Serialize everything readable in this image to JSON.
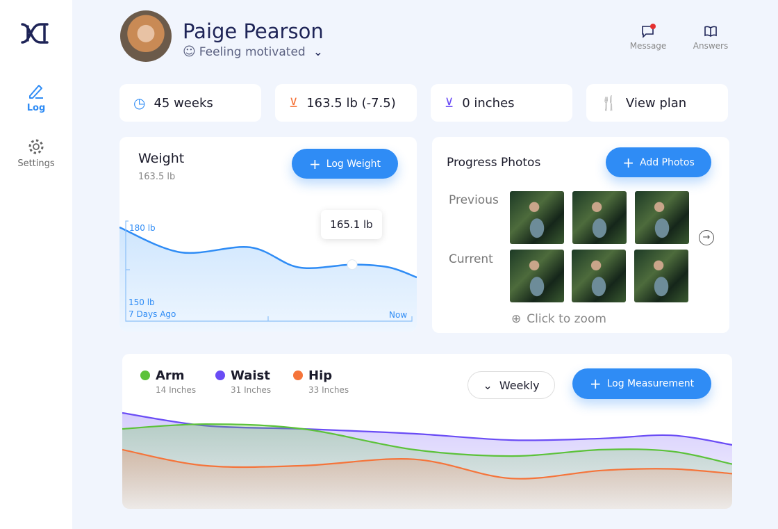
{
  "sidebar": {
    "items": [
      {
        "label": "Log",
        "icon": "pencil-icon",
        "active": true
      },
      {
        "label": "Settings",
        "icon": "gear-icon"
      }
    ]
  },
  "header": {
    "name": "Paige Pearson",
    "mood": "Feeling motivated",
    "actions": [
      {
        "label": "Message",
        "icon": "message-icon",
        "has_notification": true
      },
      {
        "label": "Answers",
        "icon": "book-icon"
      }
    ]
  },
  "stats": [
    {
      "label": "45 weeks",
      "icon": "clock-icon",
      "color": "#2f8cf5"
    },
    {
      "label": "163.5 lb (-7.5)",
      "icon": "arrow-down-circle-icon",
      "color": "#f5743a"
    },
    {
      "label": "0 inches",
      "icon": "arrow-down-circle-icon",
      "color": "#6a4cf5"
    },
    {
      "label": "View plan",
      "icon": "fork-knife-icon",
      "color": "#5cc23a"
    }
  ],
  "weight": {
    "title": "Weight",
    "current": "163.5 lb",
    "button": "Log Weight",
    "tooltip": "165.1 lb"
  },
  "photos": {
    "title": "Progress Photos",
    "button": "Add Photos",
    "previous_label": "Previous",
    "current_label": "Current",
    "zoom_hint": "Click to zoom"
  },
  "measure": {
    "legend": [
      {
        "name": "Arm",
        "value": "14 Inches",
        "color": "#5cc23a"
      },
      {
        "name": "Waist",
        "value": "31 Inches",
        "color": "#6a4cf5"
      },
      {
        "name": "Hip",
        "value": "33 Inches",
        "color": "#f5743a"
      }
    ],
    "period": "Weekly",
    "button": "Log Measurement"
  },
  "chart_data": [
    {
      "type": "area",
      "ytick_labels": [
        "180 lb",
        "150 lb"
      ],
      "xtick_labels": [
        "7 Days Ago",
        "Now"
      ],
      "ylim": [
        150,
        180
      ],
      "x": [
        0,
        1,
        2,
        3,
        4,
        5,
        6
      ],
      "values": [
        180,
        170,
        172,
        164,
        165.1,
        164,
        160
      ],
      "highlight": {
        "x": 4,
        "value": 165.1,
        "label": "165.1 lb"
      },
      "color": "#2f8cf5"
    },
    {
      "type": "area",
      "series": [
        {
          "name": "Waist",
          "values": [
            60,
            52,
            50,
            47,
            43,
            44,
            46,
            40
          ],
          "color": "#6a4cf5"
        },
        {
          "name": "Arm",
          "values": [
            50,
            53,
            50,
            37,
            33,
            37,
            36,
            28
          ],
          "color": "#5cc23a"
        },
        {
          "name": "Hip",
          "values": [
            37,
            27,
            27,
            31,
            19,
            24,
            25,
            22
          ],
          "color": "#f5743a"
        }
      ]
    }
  ]
}
